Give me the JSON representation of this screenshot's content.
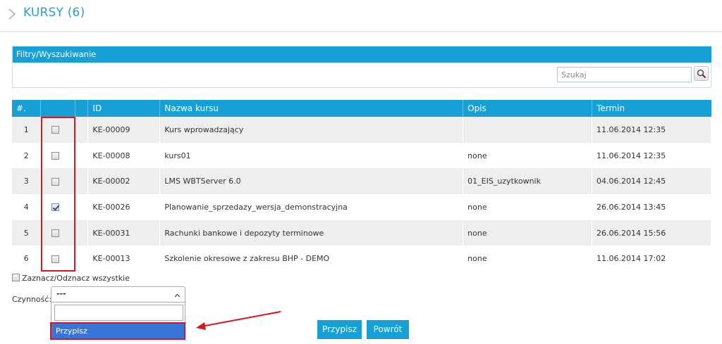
{
  "header": {
    "title": "KURSY (6)"
  },
  "filters": {
    "title": "Filtry/Wyszukiwanie",
    "search_placeholder": "Szukaj",
    "search_value": ""
  },
  "table": {
    "columns": [
      "#.",
      "",
      "",
      "ID",
      "Nazwa kursu",
      "Opis",
      "Termin"
    ],
    "rows": [
      {
        "num": "1",
        "checked": false,
        "id": "KE-00009",
        "name": "Kurs wprowadzający",
        "desc": "",
        "date": "11.06.2014 12:35"
      },
      {
        "num": "2",
        "checked": false,
        "id": "KE-00008",
        "name": "kurs01",
        "desc": "none",
        "date": "11.06.2014 12:35"
      },
      {
        "num": "3",
        "checked": false,
        "id": "KE-00002",
        "name": "LMS WBTServer 6.0",
        "desc": "01_EIS_uzytkownik",
        "date": "04.06.2014 12:45"
      },
      {
        "num": "4",
        "checked": true,
        "id": "KE-00026",
        "name": "Planowanie_sprzedazy_wersja_demonstracyjna",
        "desc": "none",
        "date": "26.06.2014 13:45"
      },
      {
        "num": "5",
        "checked": false,
        "id": "KE-00031",
        "name": "Rachunki bankowe i depozyty terminowe",
        "desc": "none",
        "date": "26.06.2014 15:56"
      },
      {
        "num": "6",
        "checked": false,
        "id": "KE-00013",
        "name": "Szkolenie okresowe z zakresu BHP - DEMO",
        "desc": "none",
        "date": "11.06.2014 17:02"
      }
    ]
  },
  "select_all": {
    "label": "Zaznacz/Odznacz wszystkie"
  },
  "action": {
    "label": "Czynność:",
    "selected": "---",
    "search_value": "",
    "options": [
      "Przypisz"
    ]
  },
  "buttons": {
    "assign": "Przypisz",
    "back": "Powrót"
  },
  "colors": {
    "accent": "#16a0d6",
    "highlight": "#e0141e",
    "option_selected": "#3875d7"
  }
}
